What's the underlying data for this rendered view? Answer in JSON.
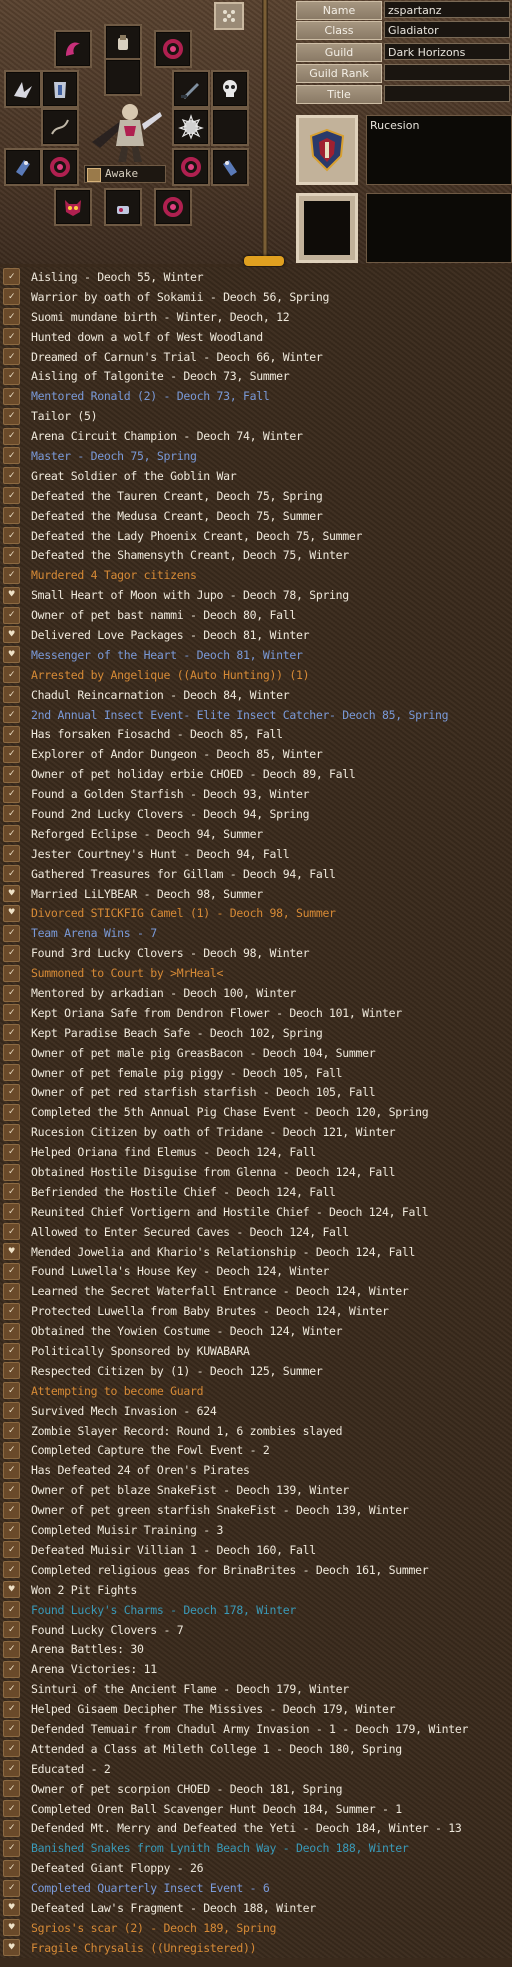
{
  "profile": {
    "fields": [
      {
        "label": "Name",
        "value": "zspartanz"
      },
      {
        "label": "Class",
        "value": "Gladiator"
      },
      {
        "label": "Guild",
        "value": "Dark Horizons"
      },
      {
        "label": "Guild Rank",
        "value": ""
      },
      {
        "label": "Title",
        "value": ""
      }
    ],
    "nation": "Rucesion",
    "status": "Awake"
  },
  "colors": {
    "default": "#efe9dc",
    "blue": "#7a9ad8",
    "orange": "#d68a36",
    "teal": "#3a9ab8"
  },
  "legend": [
    {
      "icon": "check",
      "color": "default",
      "text": "Aisling - Deoch 55, Winter"
    },
    {
      "icon": "check",
      "color": "default",
      "text": "Warrior by oath of Sokamii - Deoch 56, Spring"
    },
    {
      "icon": "check",
      "color": "default",
      "text": "Suomi mundane birth - Winter, Deoch, 12"
    },
    {
      "icon": "check",
      "color": "default",
      "text": "Hunted down a wolf of West Woodland"
    },
    {
      "icon": "check",
      "color": "default",
      "text": "Dreamed of Carnun's Trial - Deoch 66, Winter"
    },
    {
      "icon": "check",
      "color": "default",
      "text": "Aisling of Talgonite - Deoch 73, Summer"
    },
    {
      "icon": "check",
      "color": "blue",
      "text": "Mentored Ronald (2) - Deoch 73, Fall"
    },
    {
      "icon": "check",
      "color": "default",
      "text": "Tailor (5)"
    },
    {
      "icon": "check",
      "color": "default",
      "text": "Arena Circuit Champion - Deoch 74, Winter"
    },
    {
      "icon": "check",
      "color": "blue",
      "text": "Master - Deoch 75, Spring"
    },
    {
      "icon": "check",
      "color": "default",
      "text": "Great Soldier of the Goblin War"
    },
    {
      "icon": "check",
      "color": "default",
      "text": "Defeated the Tauren Creant, Deoch 75, Spring"
    },
    {
      "icon": "check",
      "color": "default",
      "text": "Defeated the Medusa Creant, Deoch 75, Summer"
    },
    {
      "icon": "check",
      "color": "default",
      "text": "Defeated the Lady Phoenix Creant, Deoch 75, Summer"
    },
    {
      "icon": "check",
      "color": "default",
      "text": "Defeated the Shamensyth Creant, Deoch 75, Winter"
    },
    {
      "icon": "check",
      "color": "orange",
      "text": "Murdered 4 Tagor citizens"
    },
    {
      "icon": "heart",
      "color": "default",
      "text": "Small Heart of Moon with Jupo - Deoch 78, Spring"
    },
    {
      "icon": "check",
      "color": "default",
      "text": "Owner of pet bast nammi - Deoch 80, Fall"
    },
    {
      "icon": "heart",
      "color": "default",
      "text": "Delivered Love Packages - Deoch 81, Winter"
    },
    {
      "icon": "heart",
      "color": "blue",
      "text": "Messenger of the Heart - Deoch 81, Winter"
    },
    {
      "icon": "check",
      "color": "orange",
      "text": "Arrested by Angelique ((Auto Hunting)) (1)"
    },
    {
      "icon": "check",
      "color": "default",
      "text": "Chadul Reincarnation - Deoch 84, Winter"
    },
    {
      "icon": "check",
      "color": "blue",
      "text": "2nd Annual Insect Event- Elite Insect Catcher- Deoch 85, Spring"
    },
    {
      "icon": "check",
      "color": "default",
      "text": "Has forsaken Fiosachd - Deoch 85, Fall"
    },
    {
      "icon": "check",
      "color": "default",
      "text": "Explorer of Andor Dungeon - Deoch 85, Winter"
    },
    {
      "icon": "check",
      "color": "default",
      "text": "Owner of pet holiday erbie CHOED - Deoch 89, Fall"
    },
    {
      "icon": "check",
      "color": "default",
      "text": "Found a Golden Starfish - Deoch 93, Winter"
    },
    {
      "icon": "check",
      "color": "default",
      "text": "Found 2nd Lucky Clovers - Deoch 94, Spring"
    },
    {
      "icon": "check",
      "color": "default",
      "text": "Reforged Eclipse - Deoch 94, Summer"
    },
    {
      "icon": "check",
      "color": "default",
      "text": "Jester Courtney's Hunt - Deoch 94, Fall"
    },
    {
      "icon": "check",
      "color": "default",
      "text": "Gathered Treasures for Gillam - Deoch 94, Fall"
    },
    {
      "icon": "heart",
      "color": "default",
      "text": "Married LiLYBEAR - Deoch 98, Summer"
    },
    {
      "icon": "heart",
      "color": "orange",
      "text": "Divorced STICKFIG Camel (1) - Deoch 98, Summer"
    },
    {
      "icon": "check",
      "color": "blue",
      "text": "Team Arena Wins - 7"
    },
    {
      "icon": "check",
      "color": "default",
      "text": "Found 3rd Lucky Clovers - Deoch 98, Winter"
    },
    {
      "icon": "check",
      "color": "orange",
      "text": "Summoned to Court by >MrHeal<"
    },
    {
      "icon": "check",
      "color": "default",
      "text": "Mentored by arkadian - Deoch 100, Winter"
    },
    {
      "icon": "check",
      "color": "default",
      "text": "Kept Oriana Safe from Dendron Flower - Deoch 101, Winter"
    },
    {
      "icon": "check",
      "color": "default",
      "text": "Kept Paradise Beach Safe - Deoch 102, Spring"
    },
    {
      "icon": "check",
      "color": "default",
      "text": "Owner of pet male pig GreasBacon - Deoch 104, Summer"
    },
    {
      "icon": "check",
      "color": "default",
      "text": "Owner of pet female pig piggy - Deoch 105, Fall"
    },
    {
      "icon": "check",
      "color": "default",
      "text": "Owner of pet red starfish starfish - Deoch 105, Fall"
    },
    {
      "icon": "check",
      "color": "default",
      "text": "Completed the 5th Annual Pig Chase Event - Deoch 120, Spring"
    },
    {
      "icon": "check",
      "color": "default",
      "text": "Rucesion Citizen by oath of Tridane - Deoch 121, Winter"
    },
    {
      "icon": "check",
      "color": "default",
      "text": "Helped Oriana find Elemus - Deoch 124, Fall"
    },
    {
      "icon": "check",
      "color": "default",
      "text": "Obtained Hostile Disguise from Glenna - Deoch 124, Fall"
    },
    {
      "icon": "check",
      "color": "default",
      "text": "Befriended the Hostile Chief - Deoch 124, Fall"
    },
    {
      "icon": "check",
      "color": "default",
      "text": "Reunited Chief Vortigern and Hostile Chief - Deoch 124, Fall"
    },
    {
      "icon": "check",
      "color": "default",
      "text": "Allowed to Enter Secured Caves - Deoch 124, Fall"
    },
    {
      "icon": "heart",
      "color": "default",
      "text": "Mended Jowelia and Khario's Relationship - Deoch 124, Fall"
    },
    {
      "icon": "check",
      "color": "default",
      "text": "Found Luwella's House Key - Deoch 124, Winter"
    },
    {
      "icon": "check",
      "color": "default",
      "text": "Learned the Secret Waterfall Entrance - Deoch 124, Winter"
    },
    {
      "icon": "check",
      "color": "default",
      "text": "Protected Luwella from Baby Brutes - Deoch 124, Winter"
    },
    {
      "icon": "check",
      "color": "default",
      "text": "Obtained the Yowien Costume - Deoch 124, Winter"
    },
    {
      "icon": "check",
      "color": "default",
      "text": "Politically Sponsored by KUWABARA"
    },
    {
      "icon": "check",
      "color": "default",
      "text": "Respected Citizen by  (1) - Deoch 125, Summer"
    },
    {
      "icon": "check",
      "color": "orange",
      "text": "Attempting to become Guard"
    },
    {
      "icon": "check",
      "color": "default",
      "text": "Survived Mech Invasion - 624"
    },
    {
      "icon": "check",
      "color": "default",
      "text": "Zombie Slayer Record: Round 1, 6 zombies slayed"
    },
    {
      "icon": "check",
      "color": "default",
      "text": "Completed Capture the Fowl Event - 2"
    },
    {
      "icon": "check",
      "color": "default",
      "text": "Has Defeated 24 of Oren's Pirates"
    },
    {
      "icon": "check",
      "color": "default",
      "text": "Owner of pet blaze SnakeFist - Deoch 139, Winter"
    },
    {
      "icon": "check",
      "color": "default",
      "text": "Owner of pet green starfish SnakeFist - Deoch 139, Winter"
    },
    {
      "icon": "check",
      "color": "default",
      "text": "Completed Muisir Training - 3"
    },
    {
      "icon": "check",
      "color": "default",
      "text": "Defeated Muisir Villian 1 - Deoch 160, Fall"
    },
    {
      "icon": "check",
      "color": "default",
      "text": "Completed religious geas for BrinaBrites - Deoch 161, Summer"
    },
    {
      "icon": "heart",
      "color": "default",
      "text": "Won 2 Pit Fights"
    },
    {
      "icon": "check",
      "color": "teal",
      "text": "Found Lucky's Charms - Deoch 178, Winter"
    },
    {
      "icon": "check",
      "color": "default",
      "text": "Found Lucky Clovers - 7"
    },
    {
      "icon": "check",
      "color": "default",
      "text": "Arena Battles: 30"
    },
    {
      "icon": "check",
      "color": "default",
      "text": "Arena Victories: 11"
    },
    {
      "icon": "check",
      "color": "default",
      "text": "Sinturi of the Ancient Flame - Deoch 179, Winter"
    },
    {
      "icon": "check",
      "color": "default",
      "text": "Helped Gisaem Decipher The Missives - Deoch 179, Winter"
    },
    {
      "icon": "check",
      "color": "default",
      "text": "Defended Temuair from Chadul Army Invasion - 1 - Deoch 179, Winter"
    },
    {
      "icon": "check",
      "color": "default",
      "text": "Attended a Class at Mileth College 1 - Deoch 180, Spring"
    },
    {
      "icon": "check",
      "color": "default",
      "text": "Educated - 2"
    },
    {
      "icon": "check",
      "color": "default",
      "text": "Owner of pet scorpion CHOED - Deoch 181, Spring"
    },
    {
      "icon": "check",
      "color": "default",
      "text": "Completed Oren Ball Scavenger Hunt Deoch 184, Summer - 1"
    },
    {
      "icon": "check",
      "color": "default",
      "text": "Defended Mt. Merry and Defeated the Yeti - Deoch 184, Winter - 13"
    },
    {
      "icon": "check",
      "color": "teal",
      "text": "Banished Snakes from Lynith Beach Way - Deoch 188, Winter"
    },
    {
      "icon": "check",
      "color": "default",
      "text": "Defeated Giant Floppy - 26"
    },
    {
      "icon": "check",
      "color": "blue",
      "text": "Completed Quarterly Insect Event - 6"
    },
    {
      "icon": "heart",
      "color": "default",
      "text": "Defeated Law's Fragment - Deoch 188, Winter"
    },
    {
      "icon": "heart",
      "color": "orange",
      "text": "Sgrios's scar (2) - Deoch 189, Spring"
    },
    {
      "icon": "heart",
      "color": "orange",
      "text": "Fragile Chrysalis ((Unregistered))"
    }
  ]
}
